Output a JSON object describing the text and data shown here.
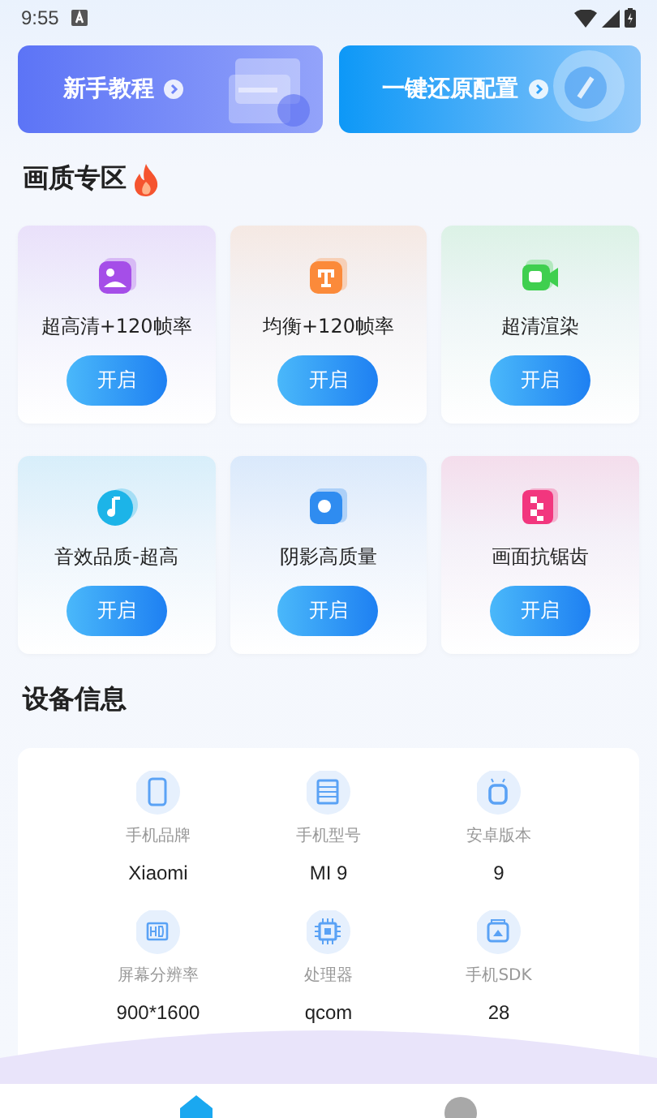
{
  "status_bar": {
    "time": "9:55"
  },
  "banners": [
    {
      "label": "新手教程",
      "kind": "tutorial"
    },
    {
      "label": "一键还原配置",
      "kind": "restore"
    }
  ],
  "quality_section": {
    "title": "画质专区",
    "items": [
      {
        "label": "超高清+120帧率",
        "button": "开启",
        "kind": "photo",
        "color": "#a54ee8"
      },
      {
        "label": "均衡+120帧率",
        "button": "开启",
        "kind": "balance",
        "color": "#fb8a3a"
      },
      {
        "label": "超清渲染",
        "button": "开启",
        "kind": "video",
        "color": "#3fcf4f"
      },
      {
        "label": "音效品质-超高",
        "button": "开启",
        "kind": "music",
        "color": "#1cb4e8"
      },
      {
        "label": "阴影高质量",
        "button": "开启",
        "kind": "shadow",
        "color": "#2f8cf0"
      },
      {
        "label": "画面抗锯齿",
        "button": "开启",
        "kind": "mosaic",
        "color": "#f2367e"
      }
    ]
  },
  "device_section": {
    "title": "设备信息",
    "items": [
      {
        "label": "手机品牌",
        "value": "Xiaomi",
        "kind": "phone"
      },
      {
        "label": "手机型号",
        "value": "MI 9",
        "kind": "list"
      },
      {
        "label": "安卓版本",
        "value": "9",
        "kind": "android"
      },
      {
        "label": "屏幕分辨率",
        "value": "900*1600",
        "kind": "hd"
      },
      {
        "label": "处理器",
        "value": "qcom",
        "kind": "chip"
      },
      {
        "label": "手机SDK",
        "value": "28",
        "kind": "sdk"
      }
    ]
  },
  "bottom_nav": [
    {
      "kind": "home",
      "selected": true
    },
    {
      "kind": "profile",
      "selected": false
    }
  ]
}
